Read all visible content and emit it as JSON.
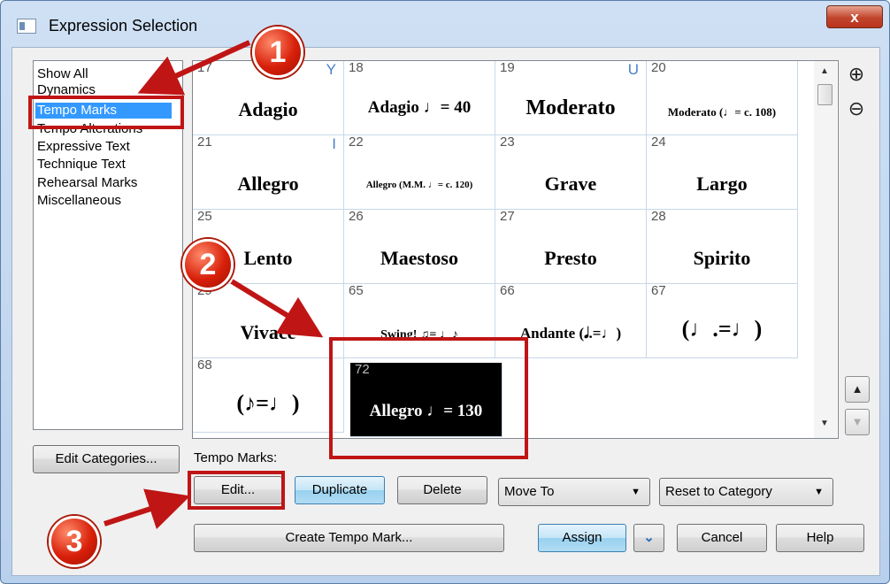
{
  "window": {
    "title": "Expression Selection",
    "close_label": "x"
  },
  "categories": {
    "items": [
      {
        "label": "Show All"
      },
      {
        "label": "Dynamics"
      },
      {
        "label": "Tempo Marks",
        "selected": true
      },
      {
        "label": "Tempo Alterations"
      },
      {
        "label": "Expressive Text"
      },
      {
        "label": "Technique Text"
      },
      {
        "label": "Rehearsal Marks"
      },
      {
        "label": "Miscellaneous"
      }
    ],
    "edit_button": "Edit Categories..."
  },
  "grid": {
    "cells": [
      {
        "num": "17",
        "key": "Y",
        "text": "Adagio"
      },
      {
        "num": "18",
        "key": "",
        "text": "Adagio ♩= 40"
      },
      {
        "num": "19",
        "key": "U",
        "text": "Moderato"
      },
      {
        "num": "20",
        "key": "",
        "text": "Moderato (♩= c. 108)"
      },
      {
        "num": "21",
        "key": "I",
        "text": "Allegro"
      },
      {
        "num": "22",
        "key": "",
        "text": "Allegro (M.M. ♩= c. 120)"
      },
      {
        "num": "23",
        "key": "",
        "text": "Grave"
      },
      {
        "num": "24",
        "key": "",
        "text": "Largo"
      },
      {
        "num": "25",
        "key": "",
        "text": "Lento"
      },
      {
        "num": "26",
        "key": "",
        "text": "Maestoso"
      },
      {
        "num": "27",
        "key": "",
        "text": "Presto"
      },
      {
        "num": "28",
        "key": "",
        "text": "Spirito"
      },
      {
        "num": "29",
        "key": "",
        "text": "Vivace"
      },
      {
        "num": "65",
        "key": "",
        "text": "Swing! ♫= ♩♪"
      },
      {
        "num": "66",
        "key": "",
        "text": "Andante (𝅗𝅥.=♩)"
      },
      {
        "num": "67",
        "key": "",
        "text": "(♩.=♩)"
      },
      {
        "num": "68",
        "key": "",
        "text": "(♪=♩)"
      },
      {
        "num": "72",
        "key": "",
        "text": "Allegro ♩= 130",
        "selected": true
      }
    ]
  },
  "scroll": {
    "up": "▲",
    "down": "▼"
  },
  "zoom": {
    "in_icon": "⊕",
    "out_icon": "⊖"
  },
  "side_buttons": {
    "up": "▲",
    "down": "▼"
  },
  "section_label": "Tempo Marks:",
  "buttons": {
    "edit": "Edit...",
    "duplicate": "Duplicate",
    "delete": "Delete",
    "create": "Create Tempo Mark...",
    "assign": "Assign",
    "assign_menu": "⌄",
    "cancel": "Cancel",
    "help": "Help"
  },
  "selects": {
    "move_to": "Move To",
    "reset": "Reset to Category"
  },
  "annotations": {
    "one": "1",
    "two": "2",
    "three": "3"
  },
  "colors": {
    "annotation": "#c01515",
    "selection": "#3399ff"
  }
}
